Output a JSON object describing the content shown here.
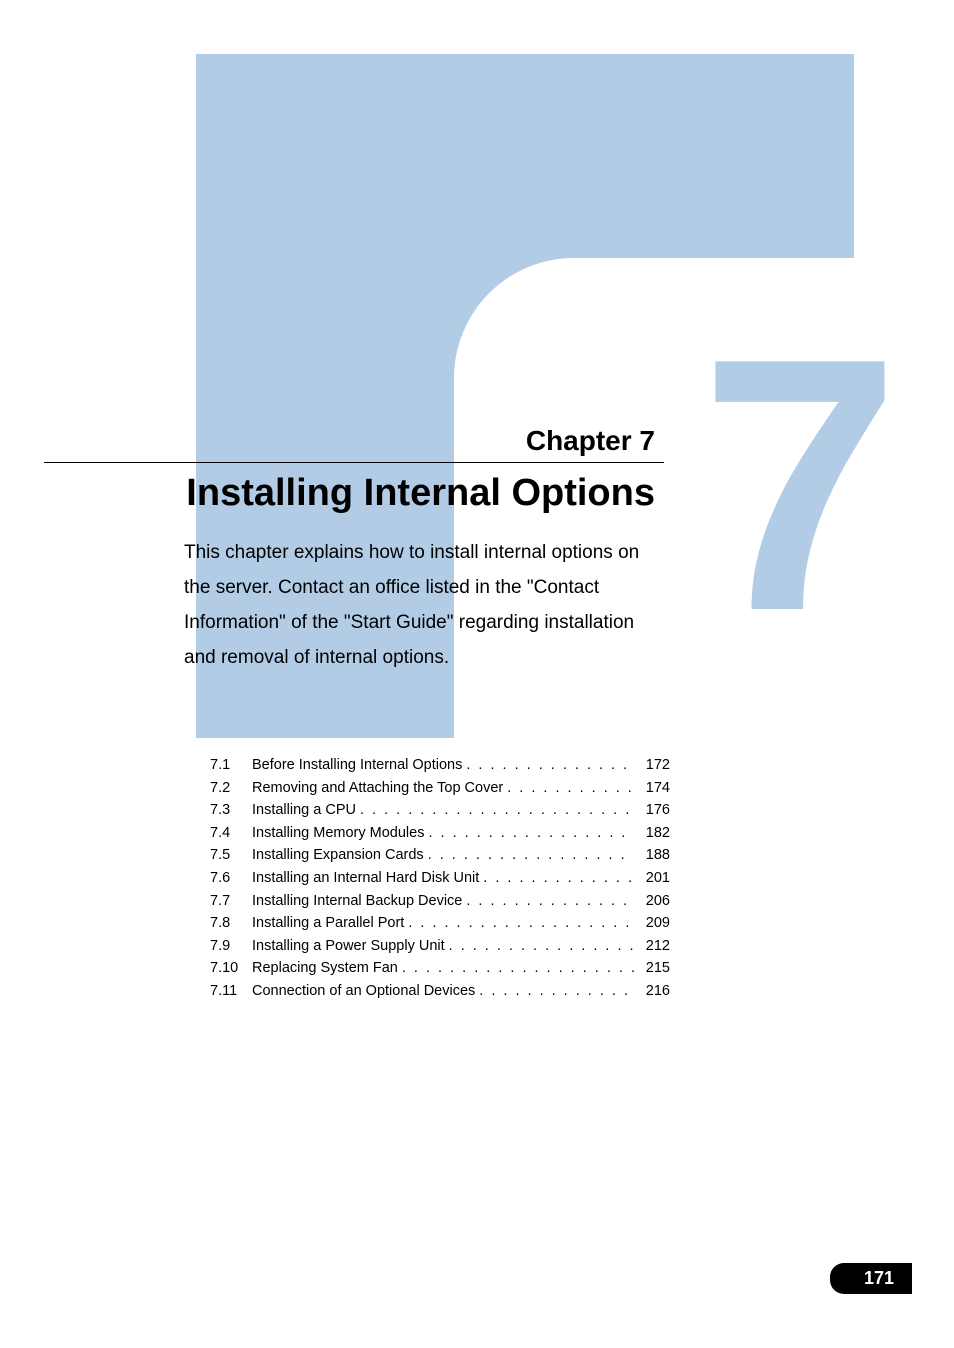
{
  "chapter": {
    "label": "Chapter 7",
    "big_number": "7",
    "title": "Installing Internal Options",
    "intro": "This chapter explains how to install internal options on the server. Contact an office listed in the \"Contact Information\" of the \"Start Guide\" regarding installation and removal of internal options."
  },
  "toc": [
    {
      "num": "7.1",
      "title": "Before Installing Internal Options",
      "page": "172"
    },
    {
      "num": "7.2",
      "title": "Removing and Attaching the Top Cover",
      "page": "174"
    },
    {
      "num": "7.3",
      "title": "Installing a CPU",
      "page": "176"
    },
    {
      "num": "7.4",
      "title": "Installing Memory Modules",
      "page": "182"
    },
    {
      "num": "7.5",
      "title": "Installing Expansion Cards",
      "page": "188"
    },
    {
      "num": "7.6",
      "title": "Installing an Internal Hard Disk Unit",
      "page": "201"
    },
    {
      "num": "7.7",
      "title": "Installing Internal Backup Device",
      "page": "206"
    },
    {
      "num": "7.8",
      "title": "Installing a Parallel Port",
      "page": "209"
    },
    {
      "num": "7.9",
      "title": "Installing a Power Supply Unit",
      "page": "212"
    },
    {
      "num": "7.10",
      "title": "Replacing System Fan",
      "page": "215"
    },
    {
      "num": "7.11",
      "title": "Connection of an Optional Devices",
      "page": "216"
    }
  ],
  "page_number": "171"
}
